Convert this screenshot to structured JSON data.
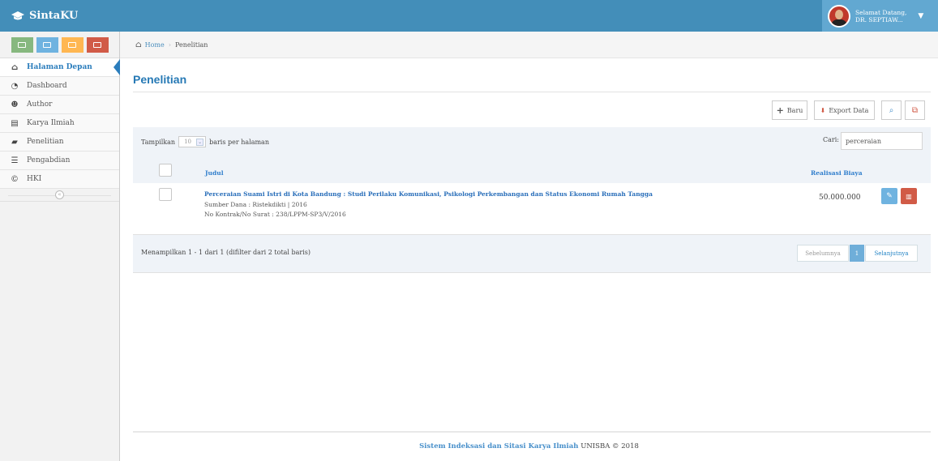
{
  "app": {
    "brand": "SintaKU",
    "user_greeting": "Selamat Datang,",
    "user_name": "DR. SEPTIAW..."
  },
  "sidebar": {
    "shortcuts": [
      {
        "icon": "chart-icon",
        "color": "#87b87f"
      },
      {
        "icon": "pencil-icon",
        "color": "#6fb3e0"
      },
      {
        "icon": "users-icon",
        "color": "#ffb752"
      },
      {
        "icon": "cogs-icon",
        "color": "#d15b47"
      }
    ],
    "items": [
      {
        "label": "Halaman Depan",
        "icon": "home-icon",
        "active": true
      },
      {
        "label": "Dashboard",
        "icon": "dashboard-icon",
        "active": false
      },
      {
        "label": "Author",
        "icon": "users-icon",
        "active": false
      },
      {
        "label": "Karya Ilmiah",
        "icon": "file-icon",
        "active": false
      },
      {
        "label": "Penelitian",
        "icon": "book-icon",
        "active": false
      },
      {
        "label": "Pengabdian",
        "icon": "list-icon",
        "active": false
      },
      {
        "label": "HKI",
        "icon": "copyright-icon",
        "active": false
      }
    ]
  },
  "breadcrumb": {
    "home": "Home",
    "current": "Penelitian"
  },
  "page": {
    "title": "Penelitian"
  },
  "toolbar": {
    "new_label": "Baru",
    "export_label": "Export Data"
  },
  "table": {
    "show_prefix": "Tampilkan",
    "page_length": "10",
    "show_suffix": "baris per halaman",
    "search_label": "Cari:",
    "search_value": "perceraian",
    "col_title": "Judul",
    "col_cost": "Realisasi Biaya",
    "rows": [
      {
        "title": "Perceraian Suami Istri di Kota Bandung : Studi Perilaku Komunikasi, Psikologi Perkembangan dan Status Ekonomi Rumah Tangga",
        "source": "Sumber Dana : Ristekdikti | 2016",
        "contract": "No Kontrak/No Surat : 238/LPPM-SP3/V/2016",
        "cost": "50.000.000"
      }
    ],
    "info": "Menampilkan 1 - 1 dari 1 (difilter dari 2 total baris)",
    "pager_prev": "Sebelumnya",
    "pager_current": "1",
    "pager_next": "Selanjutnya"
  },
  "footer": {
    "system_name": "Sistem Indeksasi dan Sitasi Karya Ilmiah",
    "org": "UNISBA © 2018"
  }
}
